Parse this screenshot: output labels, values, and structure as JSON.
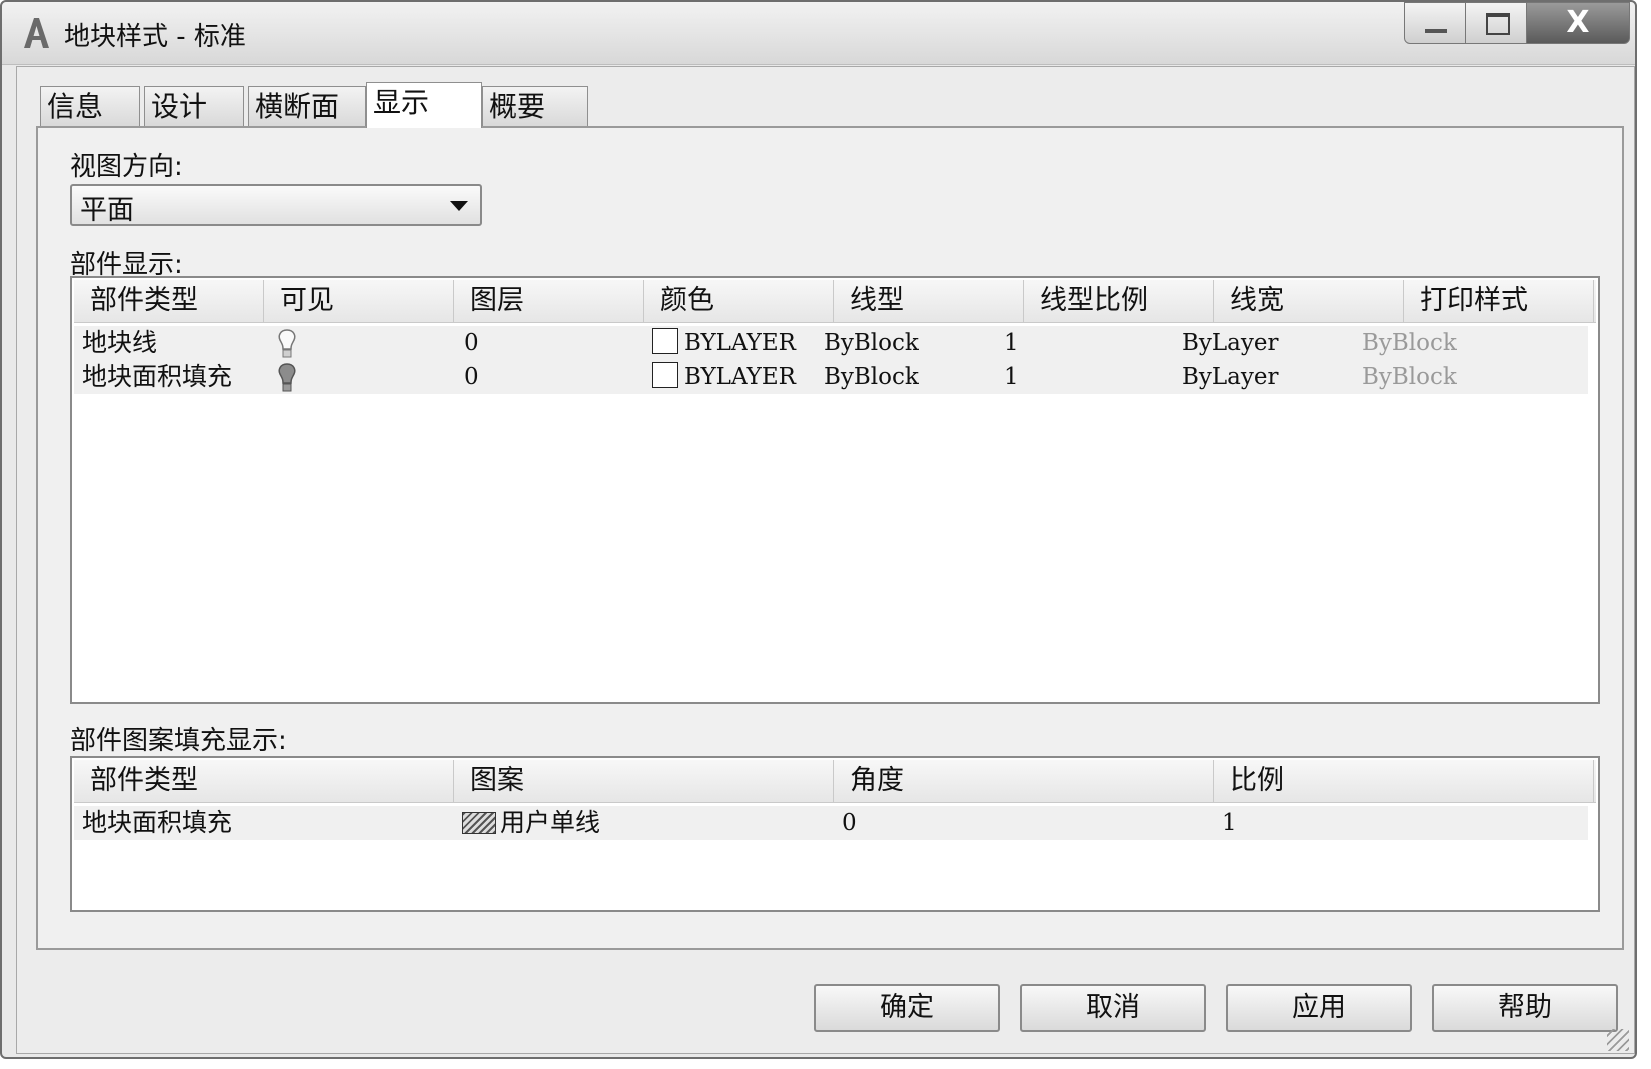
{
  "window": {
    "title": "地块样式 - 标准",
    "controls": {
      "close": "X"
    }
  },
  "tabs": [
    {
      "label": "信息",
      "active": false
    },
    {
      "label": "设计",
      "active": false
    },
    {
      "label": "横断面",
      "active": false
    },
    {
      "label": "显示",
      "active": true
    },
    {
      "label": "概要",
      "active": false
    }
  ],
  "view": {
    "label": "视图方向:",
    "selected": "平面"
  },
  "component_display": {
    "label": "部件显示:",
    "columns": [
      "部件类型",
      "可见",
      "图层",
      "颜色",
      "线型",
      "线型比例",
      "线宽",
      "打印样式"
    ],
    "rows": [
      {
        "type": "地块线",
        "visible": "on",
        "layer": "0",
        "color": "BYLAYER",
        "linetype": "ByBlock",
        "scale": "1",
        "lineweight": "ByLayer",
        "plotstyle": "ByBlock"
      },
      {
        "type": "地块面积填充",
        "visible": "off",
        "layer": "0",
        "color": "BYLAYER",
        "linetype": "ByBlock",
        "scale": "1",
        "lineweight": "ByLayer",
        "plotstyle": "ByBlock"
      }
    ]
  },
  "hatch_display": {
    "label": "部件图案填充显示:",
    "columns": [
      "部件类型",
      "图案",
      "角度",
      "比例"
    ],
    "rows": [
      {
        "type": "地块面积填充",
        "pattern": "用户单线",
        "angle": "0",
        "scale": "1"
      }
    ]
  },
  "buttons": {
    "ok": "确定",
    "cancel": "取消",
    "apply": "应用",
    "help": "帮助"
  }
}
